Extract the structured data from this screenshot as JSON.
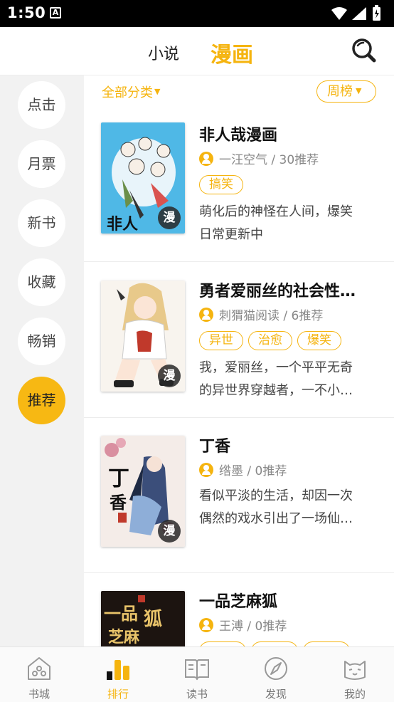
{
  "status_bar": {
    "time": "1:50",
    "notif_letter": "A"
  },
  "header": {
    "tab_novel": "小说",
    "tab_comic": "漫画"
  },
  "side_menu": [
    "点击",
    "月票",
    "新书",
    "收藏",
    "畅销",
    "推荐"
  ],
  "side_active": "推荐",
  "filters": {
    "category": "全部分类",
    "period": "周榜"
  },
  "books": [
    {
      "title": "非人哉漫画",
      "author": "一汪空气",
      "recommend": "30推荐",
      "tags": [
        "搞笑"
      ],
      "desc_line1": "萌化后的神怪在人间，爆笑",
      "desc_line2": "日常更新中",
      "badge": "漫"
    },
    {
      "title": "勇者爱丽丝的社会性…",
      "author": "刺猬猫阅读",
      "recommend": "6推荐",
      "tags": [
        "异世",
        "治愈",
        "爆笑"
      ],
      "desc_line1": "我，爱丽丝，一个平平无奇",
      "desc_line2": "的异世界穿越者，一不小…",
      "badge": "漫"
    },
    {
      "title": "丁香",
      "author": "绺墨",
      "recommend": "0推荐",
      "tags": [],
      "desc_line1": "看似平淡的生活，却因一次",
      "desc_line2": "偶然的戏水引出了一场仙…",
      "badge": "漫"
    },
    {
      "title": "一品芝麻狐",
      "author": "王溥",
      "recommend": "0推荐",
      "tags": [],
      "desc_line1": "",
      "desc_line2": "",
      "badge": ""
    }
  ],
  "bottom_nav": [
    {
      "label": "书城",
      "icon": "home-icon"
    },
    {
      "label": "排行",
      "icon": "ranking-icon"
    },
    {
      "label": "读书",
      "icon": "book-icon"
    },
    {
      "label": "发现",
      "icon": "compass-icon"
    },
    {
      "label": "我的",
      "icon": "cat-face-icon"
    }
  ],
  "active_nav": "排行",
  "colors": {
    "accent": "#f5b40f",
    "side_bg": "#f2f2f2"
  }
}
